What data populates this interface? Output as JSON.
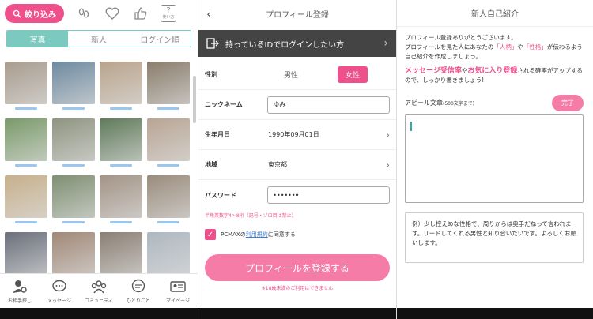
{
  "search": {
    "filter_label": "絞り込み",
    "help_label": "使い方",
    "tabs": [
      {
        "label": "写真",
        "active": true
      },
      {
        "label": "新人",
        "active": false
      },
      {
        "label": "ログイン順",
        "active": false
      }
    ],
    "photo_colors": [
      "#a89c8e",
      "#6e8aa0",
      "#b9a48c",
      "#8a7d6c",
      "#7a9a6a",
      "#8e9480",
      "#5f7a5a",
      "#b8a594",
      "#c7b08c",
      "#7e8f72",
      "#a39486",
      "#9a8c7c",
      "#6a6f7a",
      "#a08876",
      "#8b7f73",
      "#aeb7c0"
    ],
    "nav": [
      {
        "label": "お相手探し",
        "icon": "person-search-icon"
      },
      {
        "label": "メッセージ",
        "icon": "chat-bubble-icon"
      },
      {
        "label": "コミュニティ",
        "icon": "community-icon"
      },
      {
        "label": "ひとりごと",
        "icon": "monologue-icon"
      },
      {
        "label": "マイページ",
        "icon": "profile-card-icon"
      }
    ]
  },
  "register": {
    "title": "プロフィール登録",
    "login_bar": "持っているIDでログインしたい方",
    "gender_label": "性別",
    "gender_male": "男性",
    "gender_female": "女性",
    "nickname_label": "ニックネーム",
    "nickname_value": "ゆみ",
    "birthday_label": "生年月日",
    "birthday_value": "1990年09月01日",
    "region_label": "地域",
    "region_value": "東京都",
    "password_label": "パスワード",
    "password_value": "•••••••",
    "password_hint": "半角英数字4～8桁（記号・ゾロ目は禁止）",
    "agree_prefix": "PCMAXの",
    "agree_link": "利用規約",
    "agree_suffix": "に同意する",
    "submit_label": "プロフィールを登録する",
    "note": "※18歳未満のご利用はできません"
  },
  "intro": {
    "title": "新人自己紹介",
    "line1": "プロフィール登録ありがとうございます。",
    "line2a": "プロフィールを見た人にあなたの",
    "pk1": "「人柄」",
    "line2b": "や",
    "pk2": "「性格」",
    "line2c": "が伝わるよう自己紹介を作成しましょう。",
    "emph1": "メッセージ受信率",
    "emph_mid": "や",
    "emph2": "お気に入り登録",
    "emph_rest": "される確率がアップするので、しっかり書きましょう!",
    "appeal_label": "アピール文章",
    "appeal_sub": "(500文字まで)",
    "done_label": "完了",
    "example": "例）少し控えめな性格で、周りからは奥手だねって言われます。リードしてくれる男性と知り合いたいです。よろしくお願いします。"
  }
}
